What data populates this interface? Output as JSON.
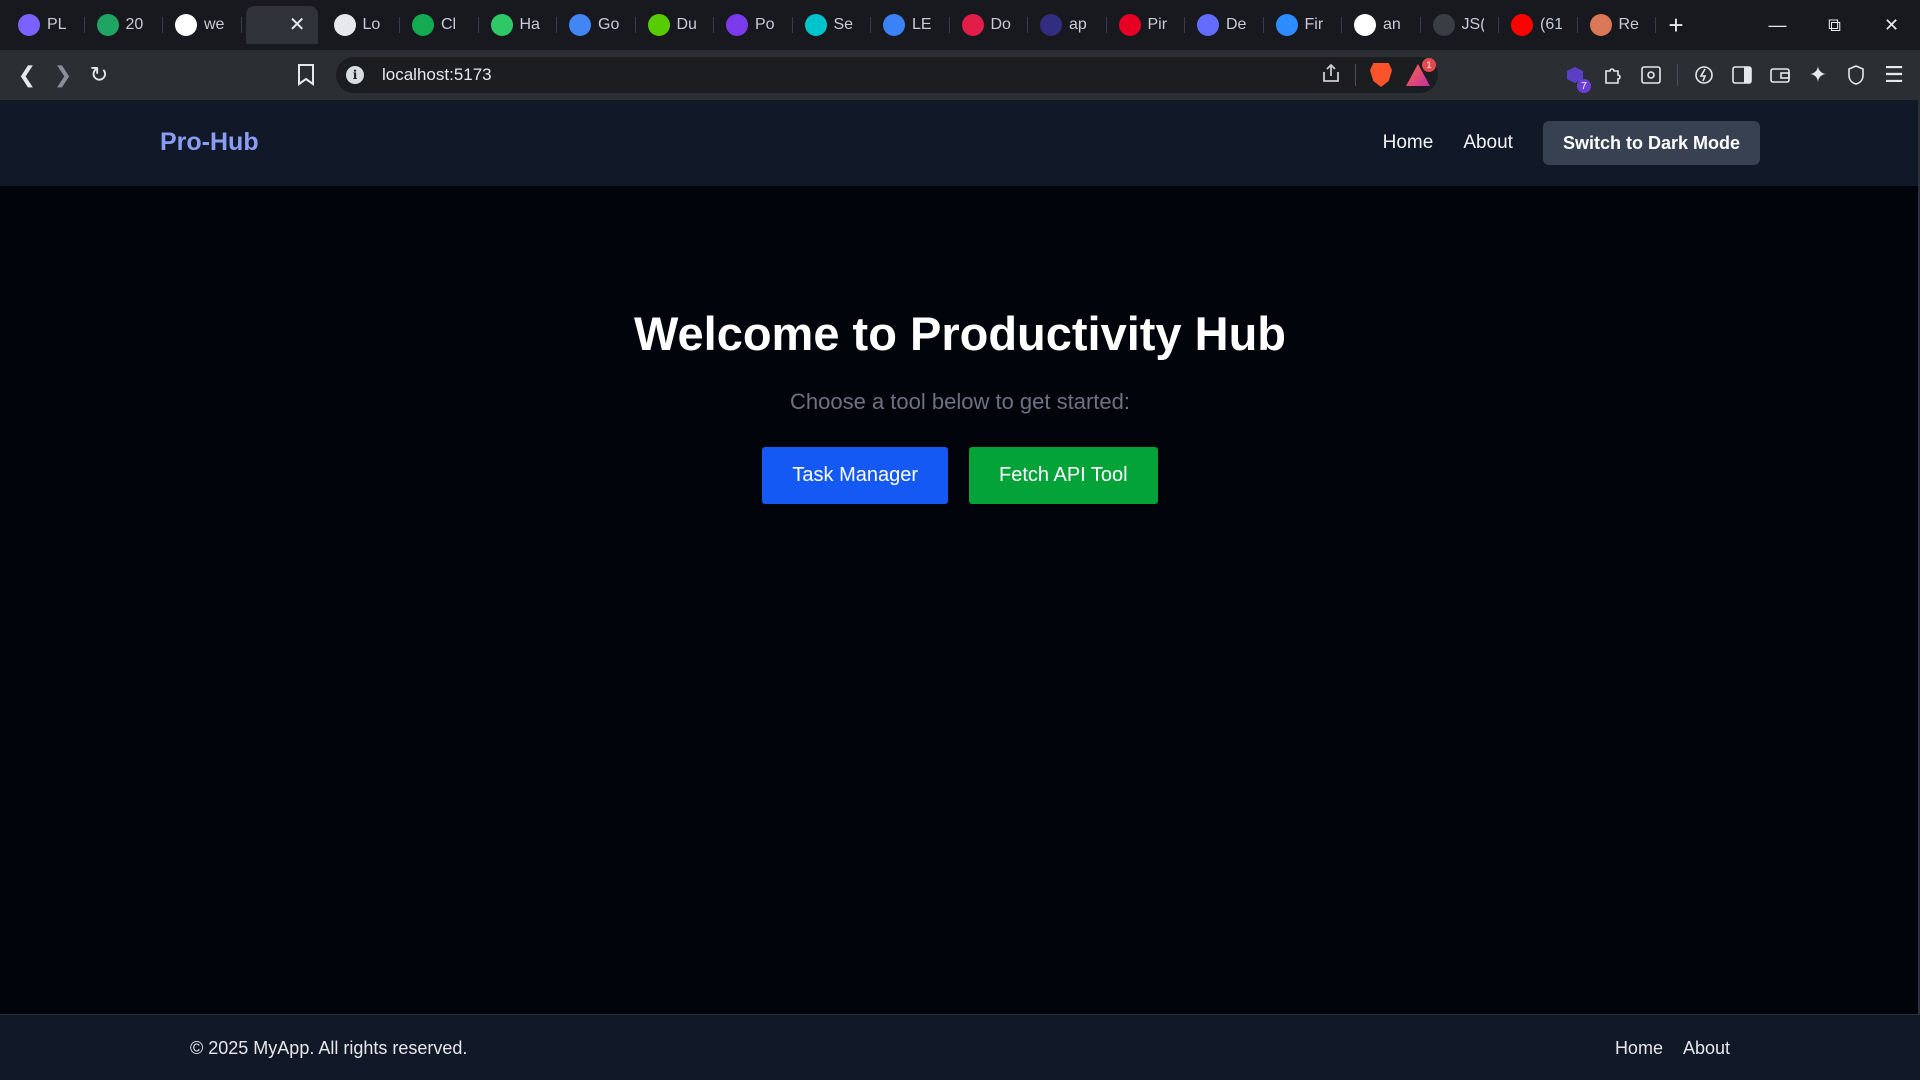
{
  "browser": {
    "tabs": [
      {
        "title": "PL",
        "icon": "prismic-icon",
        "color": "#7b61ff"
      },
      {
        "title": "20",
        "icon": "google-drive-icon",
        "color": "#1fa463"
      },
      {
        "title": "we",
        "icon": "github-icon",
        "color": "#ffffff"
      },
      {
        "title": "",
        "icon": "",
        "color": "#2f3238",
        "active": true
      },
      {
        "title": "Lo",
        "icon": "openai-icon",
        "color": "#e6e8ec"
      },
      {
        "title": "Cl",
        "icon": "mongodb-icon",
        "color": "#13aa52"
      },
      {
        "title": "Ha",
        "icon": "hackerrank-icon",
        "color": "#2ec866"
      },
      {
        "title": "Go",
        "icon": "google-translate-icon",
        "color": "#4285f4"
      },
      {
        "title": "Du",
        "icon": "duolingo-icon",
        "color": "#58cc02"
      },
      {
        "title": "Po",
        "icon": "b-icon",
        "color": "#7c3aed"
      },
      {
        "title": "Se",
        "icon": "canva-icon",
        "color": "#00c4cc"
      },
      {
        "title": "LE",
        "icon": "lens-icon",
        "color": "#3b82f6"
      },
      {
        "title": "Do",
        "icon": "heart-icon",
        "color": "#e11d48"
      },
      {
        "title": "ap",
        "icon": "p-icon",
        "color": "#312e81"
      },
      {
        "title": "Pir",
        "icon": "pinterest-icon",
        "color": "#e60023"
      },
      {
        "title": "De",
        "icon": "vite-icon",
        "color": "#646cff"
      },
      {
        "title": "Fir",
        "icon": "zoom-icon",
        "color": "#2d8cff"
      },
      {
        "title": "an",
        "icon": "github-icon",
        "color": "#ffffff"
      },
      {
        "title": "JS(",
        "icon": "code-icon",
        "color": "#3a3d44"
      },
      {
        "title": "(61",
        "icon": "youtube-icon",
        "color": "#ff0000"
      },
      {
        "title": "Re",
        "icon": "claude-icon",
        "color": "#d97757"
      }
    ],
    "address": {
      "url": "localhost:5173"
    },
    "rewards_badge": "1",
    "extensions_badge": "7"
  },
  "app": {
    "brand": "Pro-Hub",
    "nav": {
      "home": "Home",
      "about": "About",
      "theme_button": "Switch to Dark Mode"
    },
    "hero": {
      "title": "Welcome to Productivity Hub",
      "subtitle": "Choose a tool below to get started:",
      "buttons": {
        "task_manager": "Task Manager",
        "fetch_api": "Fetch API Tool"
      }
    },
    "footer": {
      "copyright": "© 2025 MyApp. All rights reserved.",
      "home": "Home",
      "about": "About"
    }
  },
  "colors": {
    "brand": "#8b9cf5",
    "navbar_bg": "#111827",
    "page_bg": "#02040c",
    "primary_button": "#1559f5",
    "success_button": "#03a33a",
    "theme_button": "#374151"
  }
}
